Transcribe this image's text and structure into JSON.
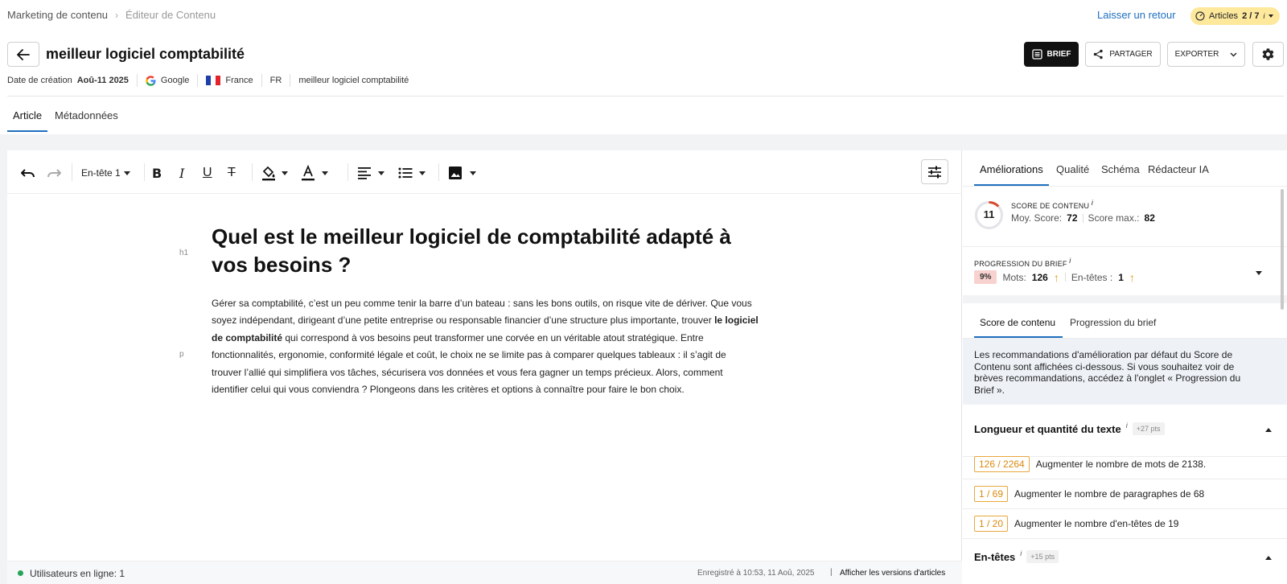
{
  "breadcrumb": {
    "item1": "Marketing de contenu",
    "item2": "Éditeur de Contenu"
  },
  "feedback": "Laisser un retour",
  "quota": {
    "label": "Articles",
    "value": "2 / 7",
    "info": "i"
  },
  "title": "meilleur logiciel comptabilité",
  "meta": {
    "created_label": "Date de création",
    "created_value": "Aoû-11 2025",
    "engine": "Google",
    "country": "France",
    "language": "FR",
    "keyword": "meilleur logiciel comptabilité"
  },
  "actions": {
    "brief": "BRIEF",
    "share": "PARTAGER",
    "export": "EXPORTER"
  },
  "tabs": {
    "article": "Article",
    "metadata": "Métadonnées"
  },
  "toolbar": {
    "heading": "En-tête 1"
  },
  "article": {
    "h1_tag": "h1",
    "p_tag": "p",
    "heading": "Quel est le meilleur logiciel de comptabilité adapté à vos besoins ?",
    "p_part1": "Gérer sa comptabilité, c’est un peu comme tenir la barre d’un bateau : sans les bons outils, on risque vite de dériver. Que vous soyez indépendant, dirigeant d’une petite entreprise ou responsable financier d’une structure plus importante, trouver ",
    "p_bold": "le logiciel de comptabilité",
    "p_part2": " qui correspond à vos besoins peut transformer une corvée en un véritable atout stratégique. Entre fonctionnalités, ergonomie, conformité légale et coût, le choix ne se limite pas à comparer quelques tableaux : il s’agit de trouver l’allié qui simplifiera vos tâches, sécurisera vos données et vous fera gagner un temps précieux. Alors, comment identifier celui qui vous conviendra ? Plongeons dans les critères et options à connaître pour faire le bon choix."
  },
  "status": {
    "online": "Utilisateurs en ligne: 1",
    "saved": "Enregistré à 10:53, 11 Aoû, 2025",
    "separator": "|",
    "versions": "Afficher les versions d'articles"
  },
  "panel": {
    "tabs": [
      "Améliorations",
      "Qualité",
      "Schéma",
      "Rédacteur IA"
    ],
    "score": {
      "title": "SCORE DE CONTENU",
      "info": "i",
      "value": "11",
      "fraction": 0.13,
      "avg_label": "Moy. Score:",
      "avg_value": "72",
      "max_label": "Score max.:",
      "max_value": "82"
    },
    "brief": {
      "title": "PROGRESSION DU BRIEF",
      "info": "i",
      "pct": "9%",
      "words_label": "Mots:",
      "words_value": "126",
      "headings_label": "En-têtes :",
      "headings_value": "1"
    },
    "subtabs": [
      "Score de contenu",
      "Progression du brief"
    ],
    "info_text": "Les recommandations d'amélioration par défaut du Score de Contenu sont affichées ci-dessous. Si vous souhaitez voir de brèves recommandations, accédez à l'onglet « Progression du Brief ».",
    "length_section": {
      "title": "Longueur et quantité du texte",
      "info": "i",
      "pts": "+27 pts",
      "rows": [
        {
          "badge": "126 / 2264",
          "text": "Augmenter le nombre de mots de 2138."
        },
        {
          "badge": "1 / 69",
          "text": "Augmenter le nombre de paragraphes de 68"
        },
        {
          "badge": "1 / 20",
          "text": "Augmenter le nombre d'en-têtes de 19"
        }
      ]
    },
    "headings_section": {
      "title": "En-têtes",
      "info": "i",
      "pts": "+15 pts"
    }
  },
  "colors": {
    "accent": "#1f6fbf",
    "brief_bg": "#111111",
    "quota_bg": "#fde89c",
    "badge": "#e9a73a",
    "score_ring": "#d9472b"
  }
}
